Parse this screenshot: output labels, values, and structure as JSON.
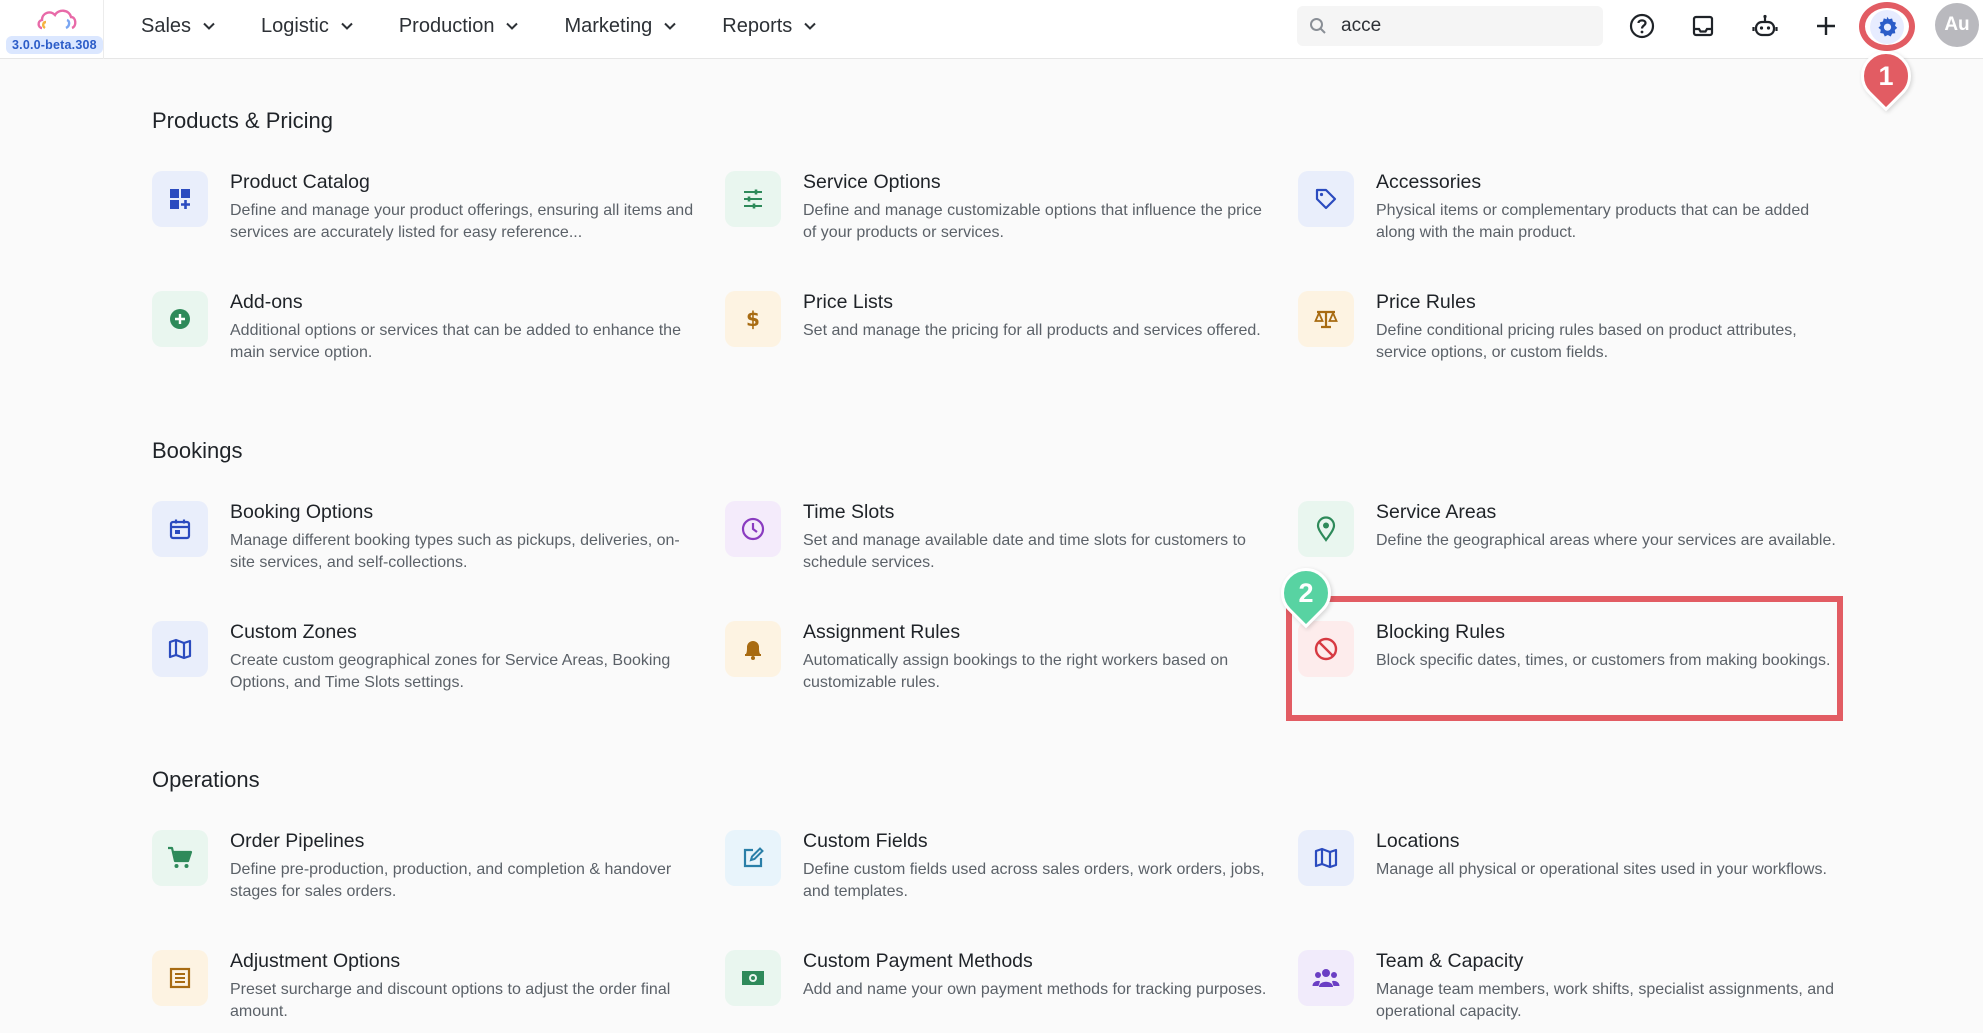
{
  "app": {
    "version": "3.0.0-beta.308"
  },
  "nav": [
    {
      "label": "Sales"
    },
    {
      "label": "Logistic"
    },
    {
      "label": "Production"
    },
    {
      "label": "Marketing"
    },
    {
      "label": "Reports"
    }
  ],
  "search": {
    "value": "acce"
  },
  "user": {
    "initials": "Au"
  },
  "markers": {
    "step1": "1",
    "step2": "2"
  },
  "colors": {
    "accent": "#2b5cc8",
    "highlight": "#e25c63",
    "marker2": "#58d3a2"
  },
  "sections": {
    "products": {
      "title": "Products & Pricing",
      "cards": [
        {
          "title": "Product Catalog",
          "desc": "Define and manage your product offerings, ensuring all items and services are accurately listed for easy reference...",
          "icon": "dashboard-add-icon"
        },
        {
          "title": "Service Options",
          "desc": "Define and manage customizable options that influence the price of your products or services.",
          "icon": "sliders-icon"
        },
        {
          "title": "Accessories",
          "desc": "Physical items or complementary products that can be added along with the main product.",
          "icon": "tag-icon"
        },
        {
          "title": "Add-ons",
          "desc": "Additional options or services that can be added to enhance the main service option.",
          "icon": "plus-circle-icon"
        },
        {
          "title": "Price Lists",
          "desc": "Set and manage the pricing for all products and services offered.",
          "icon": "dollar-icon"
        },
        {
          "title": "Price Rules",
          "desc": "Define conditional pricing rules based on product attributes, service options, or custom fields.",
          "icon": "scale-icon"
        }
      ]
    },
    "bookings": {
      "title": "Bookings",
      "cards": [
        {
          "title": "Booking Options",
          "desc": "Manage different booking types such as pickups, deliveries, on-site services, and self-collections.",
          "icon": "calendar-icon"
        },
        {
          "title": "Time Slots",
          "desc": "Set and manage available date and time slots for customers to schedule services.",
          "icon": "clock-icon"
        },
        {
          "title": "Service Areas",
          "desc": "Define the geographical areas where your services are available.",
          "icon": "map-pin-icon"
        },
        {
          "title": "Custom Zones",
          "desc": "Create custom geographical zones for Service Areas, Booking Options, and Time Slots settings.",
          "icon": "map-icon"
        },
        {
          "title": "Assignment Rules",
          "desc": "Automatically assign bookings to the right workers based on customizable rules.",
          "icon": "bell-icon"
        },
        {
          "title": "Blocking Rules",
          "desc": "Block specific dates, times, or customers from making bookings.",
          "icon": "block-icon"
        }
      ]
    },
    "operations": {
      "title": "Operations",
      "cards": [
        {
          "title": "Order Pipelines",
          "desc": "Define pre-production, production, and completion & handover stages for sales orders.",
          "icon": "cart-icon"
        },
        {
          "title": "Custom Fields",
          "desc": "Define custom fields used across sales orders, work orders, jobs, and templates.",
          "icon": "edit-icon"
        },
        {
          "title": "Locations",
          "desc": "Manage all physical or operational sites used in your workflows.",
          "icon": "map-icon"
        },
        {
          "title": "Adjustment Options",
          "desc": "Preset surcharge and discount options to adjust the order final amount.",
          "icon": "list-icon"
        },
        {
          "title": "Custom Payment Methods",
          "desc": "Add and name your own payment methods for tracking purposes.",
          "icon": "cash-icon"
        },
        {
          "title": "Team & Capacity",
          "desc": "Manage team members, work shifts, specialist assignments, and operational capacity.",
          "icon": "team-icon"
        }
      ]
    }
  }
}
